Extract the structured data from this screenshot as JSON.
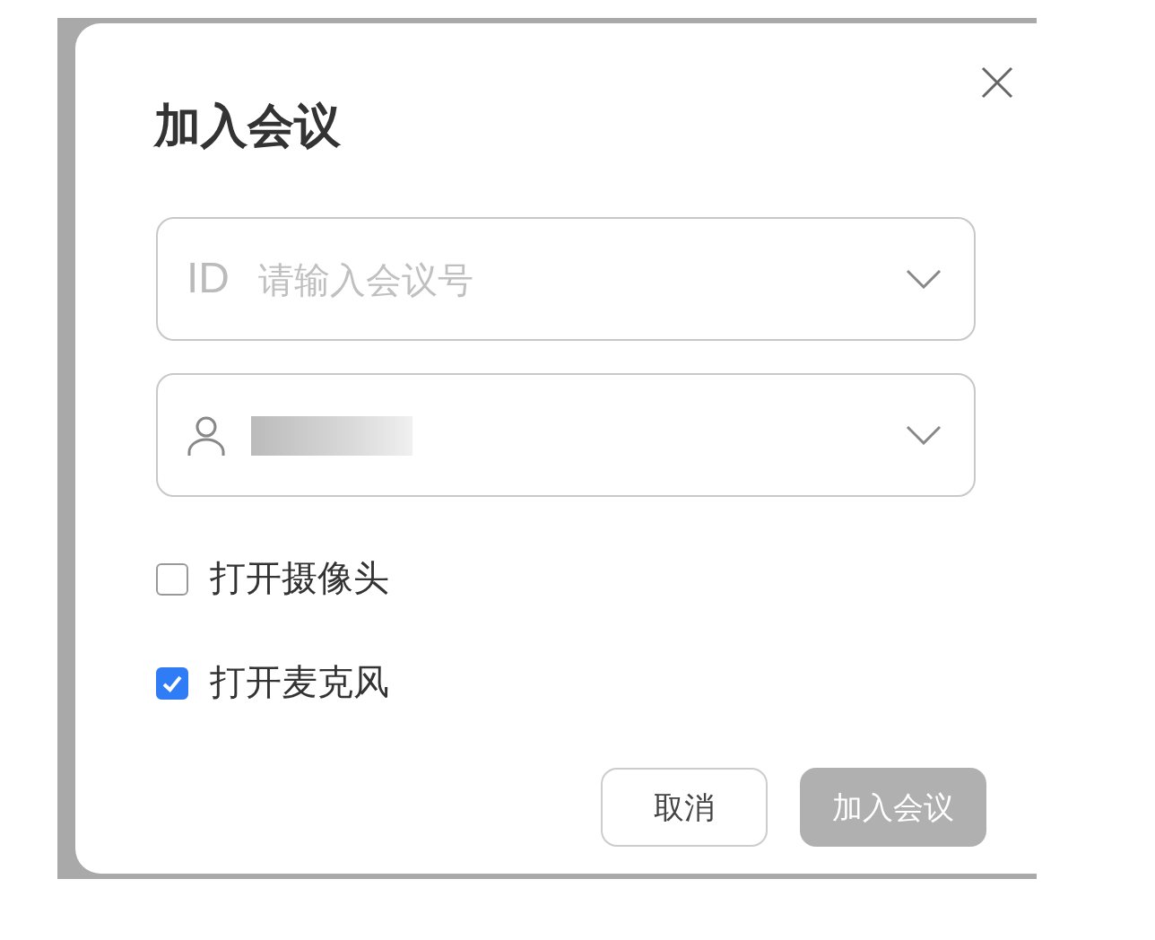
{
  "dialog": {
    "title": "加入会议"
  },
  "fields": [
    {
      "kind": "id",
      "prefix": "ID",
      "placeholder": "请输入会议号"
    },
    {
      "kind": "user",
      "value_obscured": true
    }
  ],
  "options": [
    {
      "label": "打开摄像头",
      "checked": false
    },
    {
      "label": "打开麦克风",
      "checked": true
    }
  ],
  "buttons": [
    {
      "label": "取消",
      "kind": "secondary",
      "disabled": false
    },
    {
      "label": "加入会议",
      "kind": "primary",
      "disabled": true
    }
  ]
}
